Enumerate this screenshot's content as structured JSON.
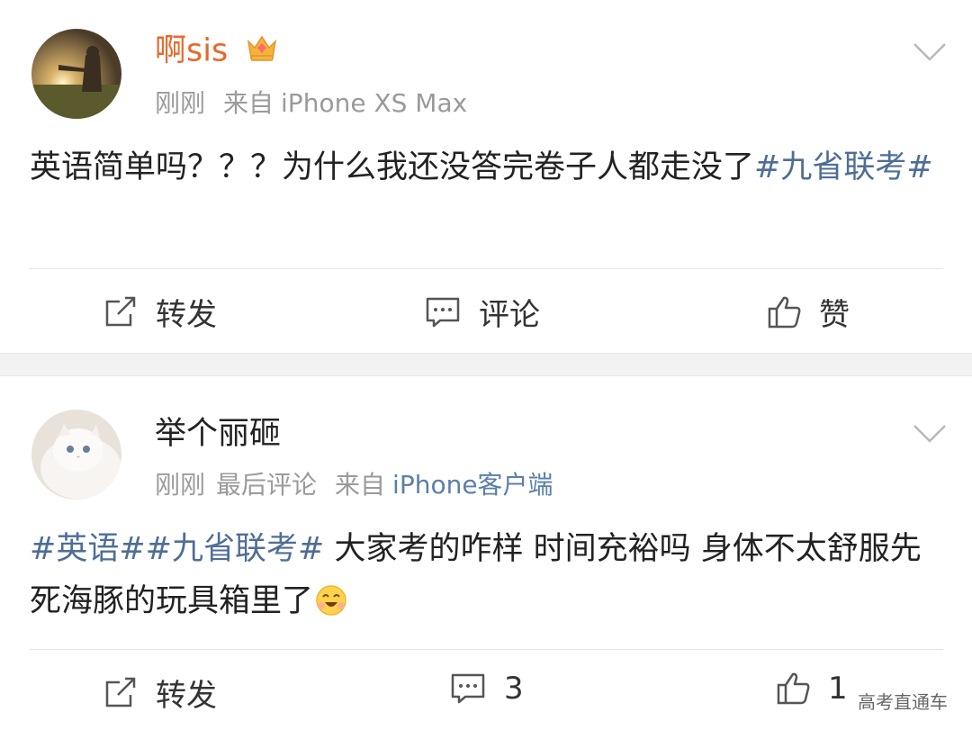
{
  "posts": [
    {
      "username": "啊sis",
      "vip_badge": "crown-vip-icon",
      "time": "刚刚",
      "source_prefix": "来自",
      "source": "iPhone XS Max",
      "content_text": "英语简单吗？？？为什么我还没答完卷子人都走没了",
      "content_tag": "#九省联考#",
      "actions": {
        "repost": "转发",
        "comment": "评论",
        "like": "赞"
      }
    },
    {
      "username": "举个丽砸",
      "time": "刚刚",
      "last_comment": "最后评论",
      "source_prefix": "来自",
      "source": "iPhone客户端",
      "content_tag1": "#英语#",
      "content_tag2": "#九省联考#",
      "content_text": " 大家考的咋样 时间充裕吗 身体不太舒服先死海豚的玩具箱里了",
      "emoji": "blushing-smile-emoji",
      "actions": {
        "repost": "转发",
        "comment": "3",
        "like": "1"
      }
    }
  ],
  "watermark": "高考直通车",
  "colors": {
    "username_vip": "#e8682a",
    "tag": "#4e6e96",
    "meta": "#9a9a9a",
    "gap": "#f2f2f2"
  }
}
